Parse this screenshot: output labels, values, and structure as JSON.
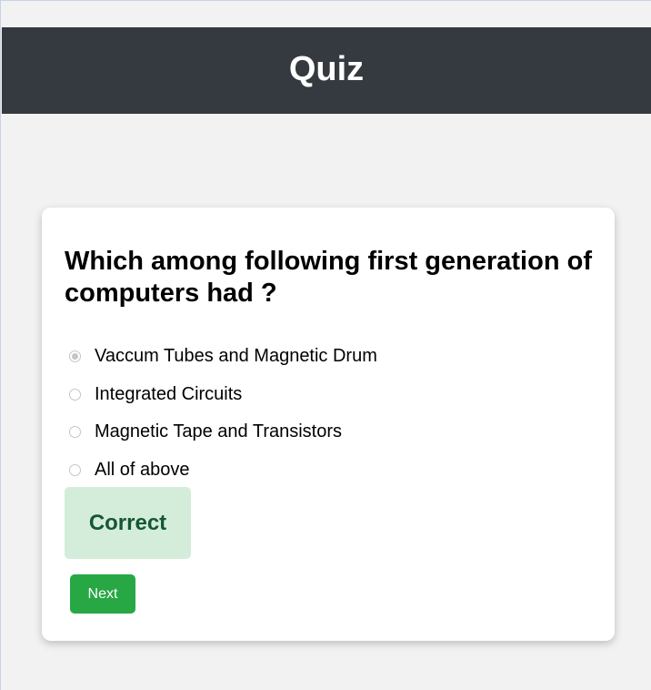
{
  "header": {
    "title": "Quiz"
  },
  "quiz": {
    "question": "Which among following first generation of computers had ?",
    "options": [
      {
        "label": "Vaccum Tubes and Magnetic Drum",
        "checked": true
      },
      {
        "label": "Integrated Circuits",
        "checked": false
      },
      {
        "label": "Magnetic Tape and Transistors",
        "checked": false
      },
      {
        "label": "All of above",
        "checked": false
      }
    ],
    "feedback": "Correct",
    "next_label": "Next"
  },
  "colors": {
    "header_bg": "#343a40",
    "page_bg": "#f2f2f2",
    "feedback_bg": "#d4edda",
    "feedback_text": "#155734",
    "next_button_bg": "#28a745"
  }
}
